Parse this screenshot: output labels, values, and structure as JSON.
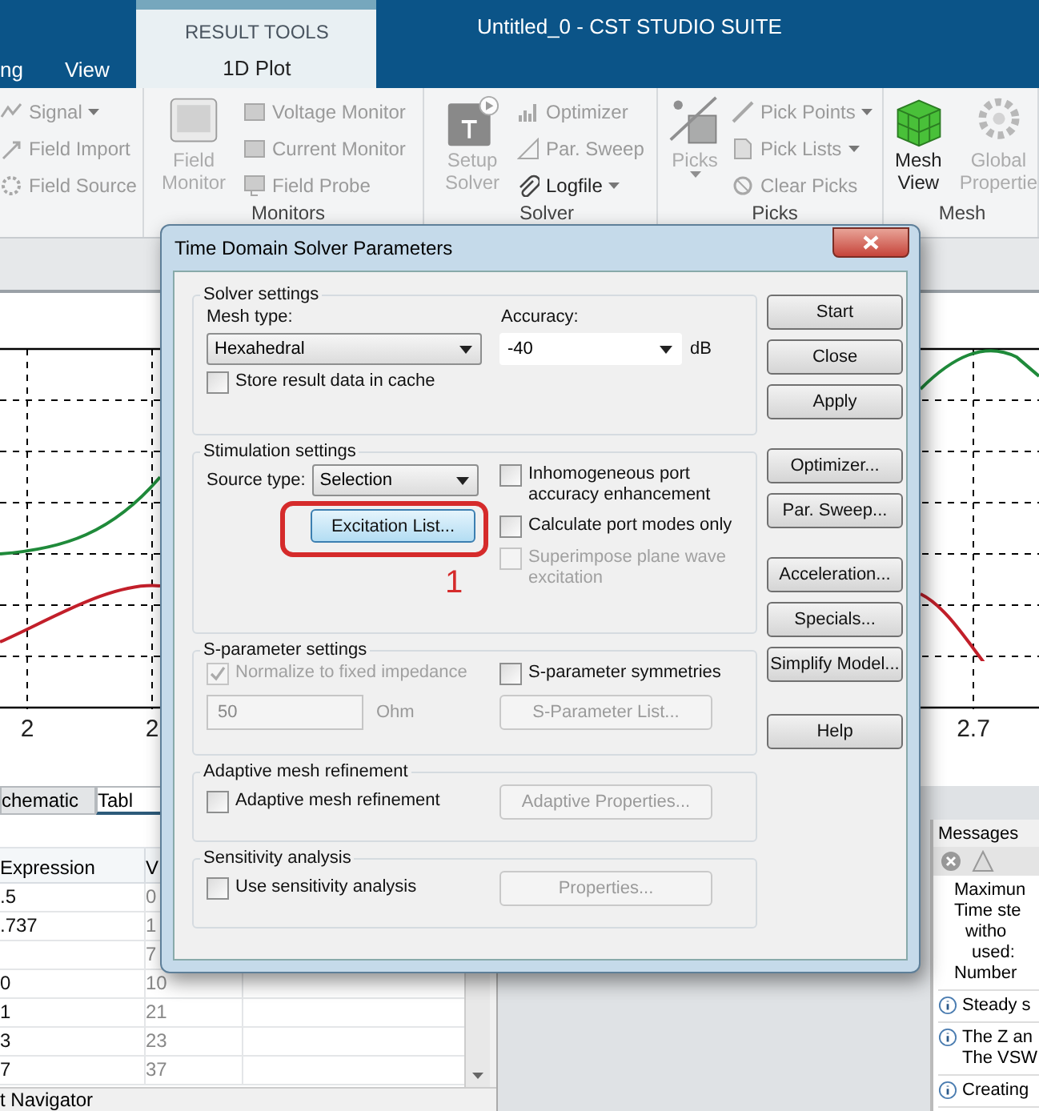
{
  "window": {
    "title": "Untitled_0 - CST STUDIO SUITE"
  },
  "menu_tabs": [
    {
      "label": "ng",
      "selected": false
    },
    {
      "label": "View",
      "selected": false
    }
  ],
  "context_tabs": {
    "group": "RESULT TOOLS",
    "tabs": [
      {
        "label": "1D Plot",
        "selected": true
      }
    ]
  },
  "ribbon": [
    {
      "items": [
        {
          "label": "Signal",
          "kind": "small",
          "disabled": true,
          "dropdown": true
        },
        {
          "label": "Field Import",
          "kind": "small",
          "disabled": true,
          "dropdown": false
        },
        {
          "label": "Field Source",
          "kind": "small",
          "disabled": true,
          "dropdown": false
        }
      ]
    },
    {
      "label": "Monitors",
      "items": [
        {
          "label": "Field Monitor",
          "kind": "large",
          "disabled": true,
          "dropdown": false
        },
        {
          "label": "Voltage Monitor",
          "kind": "small",
          "disabled": true,
          "dropdown": false
        },
        {
          "label": "Current Monitor",
          "kind": "small",
          "disabled": true,
          "dropdown": false
        },
        {
          "label": "Field Probe",
          "kind": "small",
          "disabled": true,
          "dropdown": false
        }
      ]
    },
    {
      "label": "Solver",
      "items": [
        {
          "label": "Setup Solver",
          "kind": "large",
          "disabled": true,
          "dropdown": false
        },
        {
          "label": "Optimizer",
          "kind": "small",
          "disabled": true,
          "dropdown": false
        },
        {
          "label": "Par. Sweep",
          "kind": "small",
          "disabled": true,
          "dropdown": false
        },
        {
          "label": "Logfile",
          "kind": "small",
          "disabled": false,
          "dropdown": true
        }
      ]
    },
    {
      "label": "Picks",
      "items": [
        {
          "label": "Picks",
          "kind": "large",
          "disabled": true,
          "dropdown": true
        },
        {
          "label": "Pick Points",
          "kind": "small",
          "disabled": true,
          "dropdown": true
        },
        {
          "label": "Pick Lists",
          "kind": "small",
          "disabled": true,
          "dropdown": true
        },
        {
          "label": "Clear Picks",
          "kind": "small",
          "disabled": true,
          "dropdown": false
        }
      ]
    },
    {
      "label": "Mesh",
      "items": [
        {
          "label": "Mesh View",
          "kind": "large",
          "disabled": false,
          "dropdown": false
        },
        {
          "label": "Global Propertie",
          "kind": "large",
          "disabled": true,
          "dropdown": false
        }
      ]
    }
  ],
  "plot": {
    "x_tick_labels": [
      "2",
      "2",
      "2.7"
    ]
  },
  "table_panel": {
    "tabs": [
      {
        "label": "chematic",
        "selected": false
      },
      {
        "label": "Tabl",
        "selected": true
      }
    ],
    "columns": [
      "Expression",
      "V"
    ],
    "rows": [
      {
        "expression": ".5",
        "value": "0"
      },
      {
        "expression": ".737",
        "value": "1"
      },
      {
        "value": "7"
      },
      {
        "expression": "0",
        "value": "10"
      },
      {
        "expression": "1",
        "value": "21"
      },
      {
        "expression": "3",
        "value": "23"
      },
      {
        "expression": "7",
        "value": "37"
      }
    ],
    "footer": "t Navigator"
  },
  "messages": {
    "title": "Messages",
    "items": [
      {
        "kind": "text",
        "lines": [
          "Maximun",
          "Time ste",
          "witho",
          "used:",
          "Number"
        ]
      },
      {
        "kind": "info",
        "lines": [
          "Steady s"
        ]
      },
      {
        "kind": "info",
        "lines": [
          "The Z an",
          "The VSW"
        ]
      },
      {
        "kind": "info",
        "lines": [
          "Creating"
        ]
      }
    ]
  },
  "dialog": {
    "title": "Time Domain Solver Parameters",
    "solver_settings": {
      "title": "Solver settings",
      "mesh_label": "Mesh type:",
      "mesh_value": "Hexahedral",
      "accuracy_label": "Accuracy:",
      "accuracy_value": "-40",
      "accuracy_unit": "dB",
      "cache": {
        "label": "Store result data in cache",
        "checked": false,
        "disabled": false
      }
    },
    "stimulation": {
      "title": "Stimulation settings",
      "source_label": "Source type:",
      "source_value": "Selection",
      "excitation_button": "Excitation List...",
      "annotation": "1",
      "options": [
        {
          "label": "Inhomogeneous port accuracy enhancement",
          "checked": false,
          "disabled": false
        },
        {
          "label": "Calculate port modes only",
          "checked": false,
          "disabled": false
        },
        {
          "label": "Superimpose plane wave excitation",
          "checked": false,
          "disabled": true
        }
      ]
    },
    "sparameter": {
      "title": "S-parameter settings",
      "normalize": {
        "label": "Normalize to fixed impedance",
        "checked": true,
        "disabled": true
      },
      "impedance": {
        "value": "50",
        "disabled": true
      },
      "impedance_unit": "Ohm",
      "symmetries": {
        "label": "S-parameter symmetries",
        "checked": false,
        "disabled": false
      },
      "list_button": {
        "label": "S-Parameter List...",
        "disabled": true
      }
    },
    "adaptive": {
      "title": "Adaptive mesh refinement",
      "checkbox": {
        "label": "Adaptive mesh refinement",
        "checked": false,
        "disabled": false
      },
      "button": {
        "label": "Adaptive Properties...",
        "disabled": true
      }
    },
    "sensitivity": {
      "title": "Sensitivity analysis",
      "checkbox": {
        "label": "Use sensitivity analysis",
        "checked": false,
        "disabled": false
      },
      "button": {
        "label": "Properties...",
        "disabled": true
      }
    },
    "button_groups": [
      [
        "Start",
        "Close",
        "Apply"
      ],
      [
        "Optimizer...",
        "Par. Sweep..."
      ],
      [
        "Acceleration...",
        "Specials...",
        "Simplify Model..."
      ],
      [
        "Help"
      ]
    ]
  }
}
